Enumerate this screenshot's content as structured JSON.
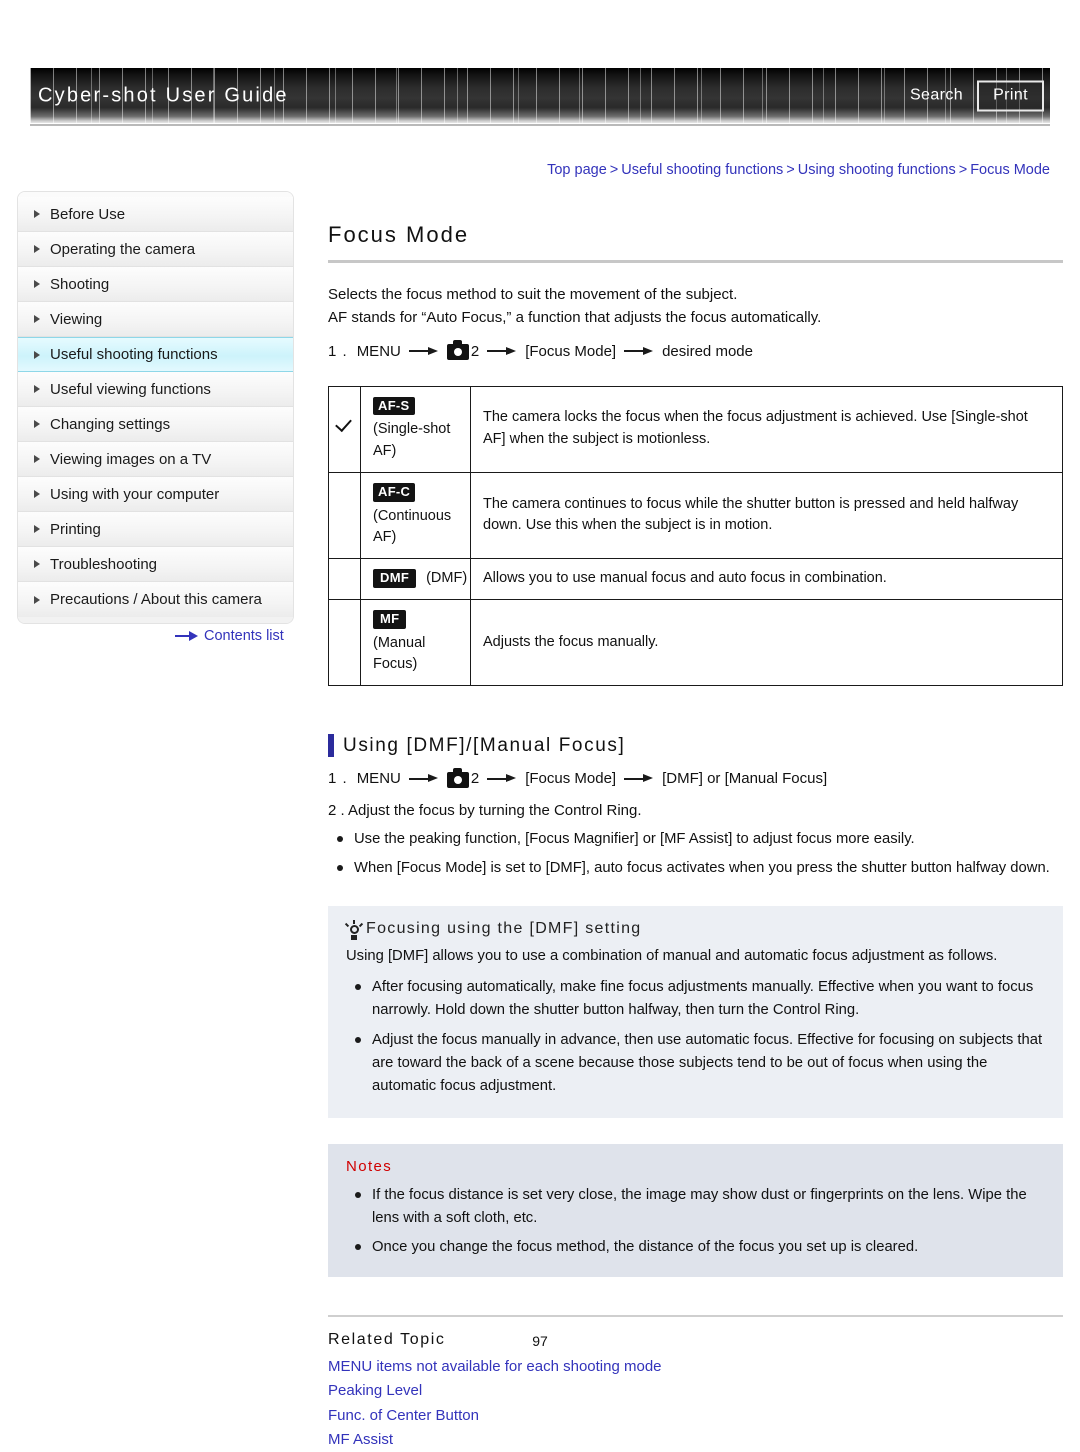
{
  "header": {
    "title": "Cyber-shot User Guide",
    "search_label": "Search",
    "print_label": "Print"
  },
  "breadcrumb": {
    "items": [
      "Top page",
      "Useful shooting functions",
      "Using shooting functions",
      "Focus Mode"
    ],
    "separator": ">"
  },
  "sidebar": {
    "items": [
      {
        "label": "Before Use",
        "active": false
      },
      {
        "label": "Operating the camera",
        "active": false
      },
      {
        "label": "Shooting",
        "active": false
      },
      {
        "label": "Viewing",
        "active": false
      },
      {
        "label": "Useful shooting functions",
        "active": true
      },
      {
        "label": "Useful viewing functions",
        "active": false
      },
      {
        "label": "Changing settings",
        "active": false
      },
      {
        "label": "Viewing images on a TV",
        "active": false
      },
      {
        "label": "Using with your computer",
        "active": false
      },
      {
        "label": "Printing",
        "active": false
      },
      {
        "label": "Troubleshooting",
        "active": false
      },
      {
        "label": "Precautions / About this camera",
        "active": false
      }
    ],
    "contents_link": "Contents list"
  },
  "main": {
    "title": "Focus Mode",
    "intro_line1": "Selects the focus method to suit the movement of the subject.",
    "intro_line2": "AF stands for “Auto Focus,” a function that adjusts the focus automatically.",
    "step1": {
      "number": "1 .",
      "menu": "MENU",
      "page": "2",
      "item": "[Focus Mode]",
      "result": "desired mode"
    },
    "table": {
      "rows": [
        {
          "checked": true,
          "badge": "AF-S",
          "label": "(Single-shot AF)",
          "description": "The camera locks the focus when the focus adjustment is achieved. Use [Single-shot AF] when the subject is motionless."
        },
        {
          "checked": false,
          "badge": "AF-C",
          "label": "(Continuous AF)",
          "description": "The camera continues to focus while the shutter button is pressed and held halfway down. Use this when the subject is in motion."
        },
        {
          "checked": false,
          "badge": "DMF",
          "label": "(DMF)",
          "description": "Allows you to use manual focus and auto focus in combination."
        },
        {
          "checked": false,
          "badge": "MF",
          "label": "(Manual Focus)",
          "description": "Adjusts the focus manually."
        }
      ]
    },
    "subsection": {
      "title": "Using [DMF]/[Manual Focus]",
      "step1": {
        "number": "1 .",
        "menu": "MENU",
        "page": "2",
        "item": "[Focus Mode]",
        "result": "[DMF] or [Manual Focus]"
      },
      "step2": "2 .  Adjust the focus by turning the Control Ring.",
      "bullets": [
        "Use the peaking function, [Focus Magnifier] or [MF Assist] to adjust focus more easily.",
        "When [Focus Mode] is set to [DMF], auto focus activates when you press the shutter button halfway down."
      ]
    },
    "tip": {
      "heading": "Focusing using the [DMF] setting",
      "lead": "Using [DMF] allows you to use a combination of manual and automatic focus adjustment as follows.",
      "bullets": [
        "After focusing automatically, make fine focus adjustments manually. Effective when you want to focus narrowly. Hold down the shutter button halfway, then turn the Control Ring.",
        "Adjust the focus manually in advance, then use automatic focus. Effective for focusing on subjects that are toward the back of a scene because those subjects tend to be out of focus when using the automatic focus adjustment."
      ]
    },
    "notes": {
      "heading": "Notes",
      "bullets": [
        "If the focus distance is set very close, the image may show dust or fingerprints on the lens. Wipe the lens with a soft cloth, etc.",
        "Once you change the focus method, the distance of the focus you set up is cleared."
      ]
    },
    "related": {
      "heading": "Related Topic",
      "links": [
        "MENU items not available for each shooting mode",
        "Peaking Level",
        "Func. of Center Button",
        "MF Assist"
      ]
    },
    "page_number": "97"
  },
  "colors": {
    "link": "#3333bb",
    "accent_bar": "#2b2b9c",
    "notes_heading": "#d00000",
    "active_item": "#cdf3fb"
  }
}
